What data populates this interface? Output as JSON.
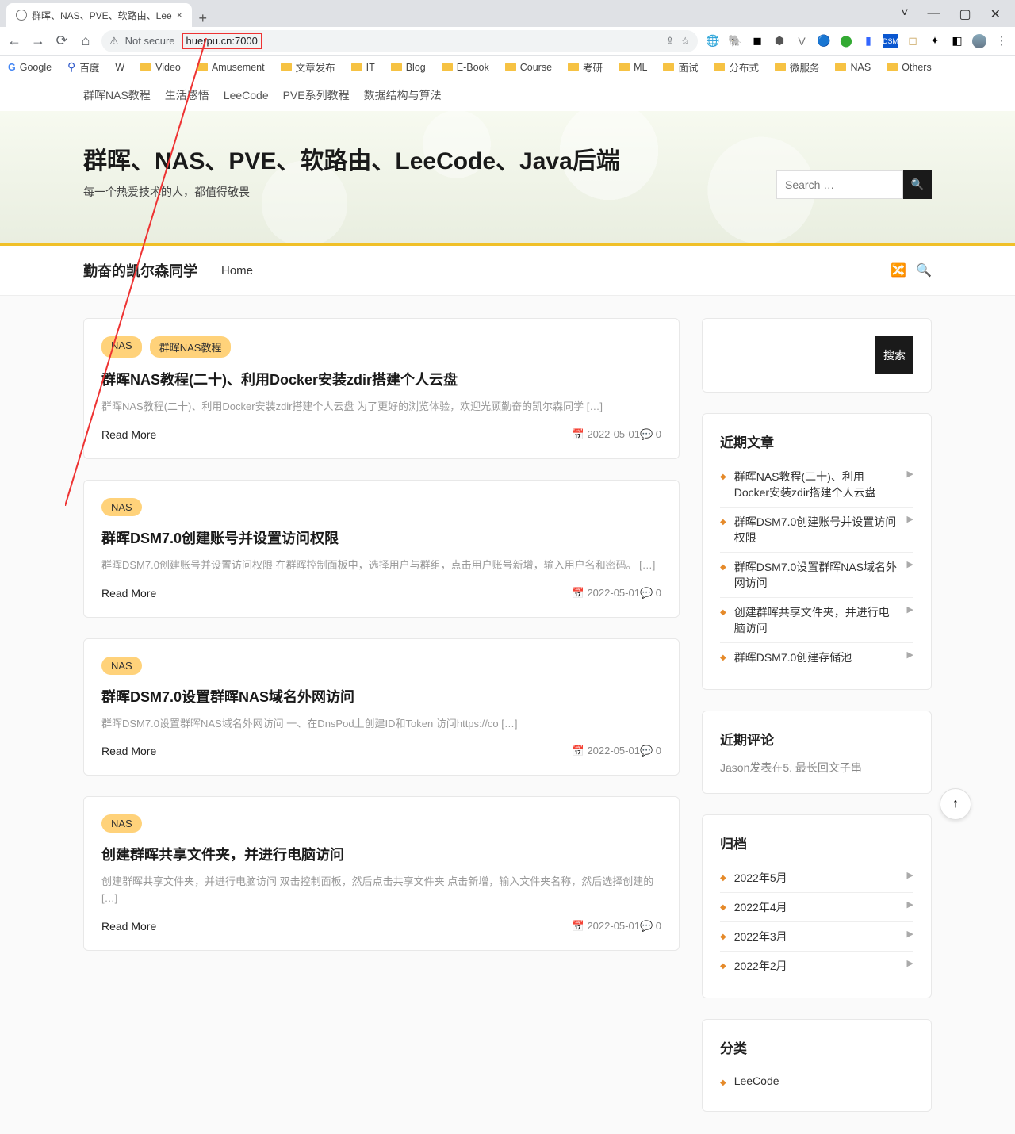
{
  "window": {
    "title": "群晖、NAS、PVE、软路由、Lee"
  },
  "url": {
    "security": "Not secure",
    "addr": "huerpu.cn:7000"
  },
  "bookmarks": [
    "Google",
    "百度",
    "W",
    "Video",
    "Amusement",
    "文章发布",
    "IT",
    "Blog",
    "E-Book",
    "Course",
    "考研",
    "ML",
    "面试",
    "分布式",
    "微服务",
    "NAS",
    "Others"
  ],
  "secnav": [
    "群晖NAS教程",
    "生活感悟",
    "LeeCode",
    "PVE系列教程",
    "数据结构与算法"
  ],
  "hero": {
    "title": "群晖、NAS、PVE、软路由、LeeCode、Java后端",
    "subtitle": "每一个热爱技术的人，都值得敬畏",
    "placeholder": "Search …"
  },
  "brand": "勤奋的凯尔森同学",
  "home": "Home",
  "posts": [
    {
      "tags": [
        "NAS",
        "群晖NAS教程"
      ],
      "title": "群晖NAS教程(二十)、利用Docker安装zdir搭建个人云盘",
      "excerpt": "群晖NAS教程(二十)、利用Docker安装zdir搭建个人云盘 为了更好的浏览体验，欢迎光顾勤奋的凯尔森同学 […]",
      "date": "2022-05-01",
      "comments": "0"
    },
    {
      "tags": [
        "NAS"
      ],
      "title": "群晖DSM7.0创建账号并设置访问权限",
      "excerpt": "群晖DSM7.0创建账号并设置访问权限 在群晖控制面板中，选择用户与群组，点击用户账号新增，输入用户名和密码。 […]",
      "date": "2022-05-01",
      "comments": "0"
    },
    {
      "tags": [
        "NAS"
      ],
      "title": "群晖DSM7.0设置群晖NAS域名外网访问",
      "excerpt": "群晖DSM7.0设置群晖NAS域名外网访问 一、在DnsPod上创建ID和Token 访问https://co […]",
      "date": "2022-05-01",
      "comments": "0"
    },
    {
      "tags": [
        "NAS"
      ],
      "title": "创建群晖共享文件夹，并进行电脑访问",
      "excerpt": "创建群晖共享文件夹，并进行电脑访问 双击控制面板，然后点击共享文件夹 点击新增，输入文件夹名称，然后选择创建的 […]",
      "date": "2022-05-01",
      "comments": "0"
    }
  ],
  "readmore": "Read More",
  "widgets": {
    "search_btn": "搜索",
    "recent_title": "近期文章",
    "recent": [
      "群晖NAS教程(二十)、利用Docker安装zdir搭建个人云盘",
      "群晖DSM7.0创建账号并设置访问权限",
      "群晖DSM7.0设置群晖NAS域名外网访问",
      "创建群晖共享文件夹，并进行电脑访问",
      "群晖DSM7.0创建存储池"
    ],
    "comments_title": "近期评论",
    "comments_text": "Jason发表在5. 最长回文子串",
    "archive_title": "归档",
    "archive": [
      "2022年5月",
      "2022年4月",
      "2022年3月",
      "2022年2月"
    ],
    "category_title": "分类",
    "categories": [
      "LeeCode"
    ]
  }
}
